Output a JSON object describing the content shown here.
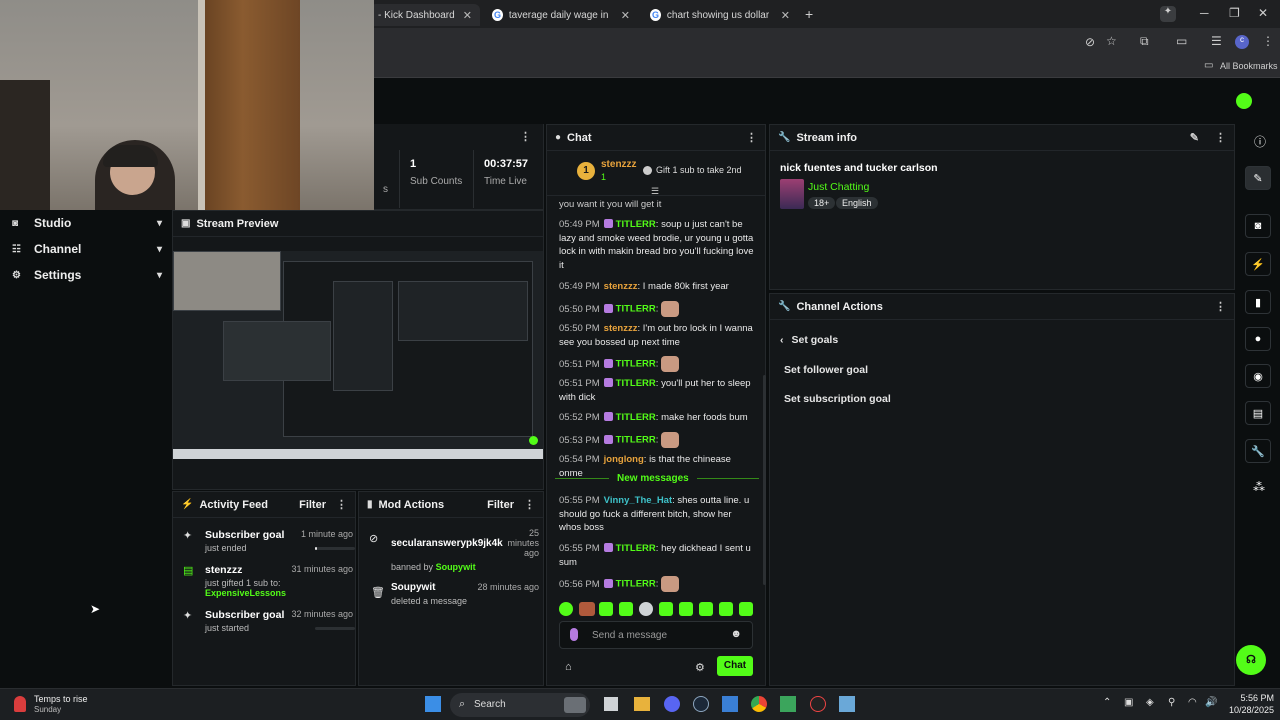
{
  "browser": {
    "tabs": [
      {
        "title": "- Kick Dashboard",
        "active": true
      },
      {
        "title": "taverage daily wage in africa - G",
        "active": false
      },
      {
        "title": "chart showing us dollar power",
        "active": false
      }
    ],
    "bookmarks_label": "All Bookmarks"
  },
  "sidebar": {
    "items": [
      {
        "label": "Studio"
      },
      {
        "label": "Channel"
      },
      {
        "label": "Settings"
      }
    ]
  },
  "stats": {
    "sub_count_value": "1",
    "sub_count_label": "Sub Counts",
    "time_live_value": "00:37:57",
    "time_live_label": "Time Live",
    "partial_label": "s"
  },
  "stream_preview": {
    "title": "Stream Preview"
  },
  "activity_feed": {
    "title": "Activity Feed",
    "filter_label": "Filter",
    "items": [
      {
        "title": "Subscriber goal",
        "sub": "just ended",
        "time": "1 minute ago",
        "progress": 0.05
      },
      {
        "title": "stenzzz",
        "sub": "just gifted 1 sub to:",
        "sub_highlight": "ExpensiveLessons",
        "time": "31 minutes ago"
      },
      {
        "title": "Subscriber goal",
        "sub": "just started",
        "time": "32 minutes ago",
        "progress": 0.0
      }
    ]
  },
  "mod_actions": {
    "title": "Mod Actions",
    "filter_label": "Filter",
    "items": [
      {
        "user": "secularanswerypk9jk4k",
        "action_prefix": "banned by",
        "actor": "Soupywit",
        "time": "25 minutes ago"
      },
      {
        "user": "Soupywit",
        "action": "deleted a message",
        "time": "28 minutes ago"
      }
    ]
  },
  "chat": {
    "title": "Chat",
    "pinned_user": "stenzzz",
    "pinned_rank": "1",
    "pinned_count": "1",
    "gift_text": "Gift 1 sub to take 2nd",
    "truncated_top": "you want it you will get it",
    "messages": [
      {
        "time": "05:49 PM",
        "user": "TITLERR",
        "color": "#53fc18",
        "badge": true,
        "text": "soup u just can't be lazy and smoke weed brodie, ur young u gotta lock in with makin bread bro you'll fucking love it"
      },
      {
        "time": "05:49 PM",
        "user": "stenzzz",
        "color": "#e8a33c",
        "badge": false,
        "text": "I made 80k first year"
      },
      {
        "time": "05:50 PM",
        "user": "TITLERR",
        "color": "#53fc18",
        "badge": true,
        "text": ""
      },
      {
        "time": "05:50 PM",
        "user": "stenzzz",
        "color": "#e8a33c",
        "badge": false,
        "text": "I'm out bro lock in I wanna see you bossed up next time"
      },
      {
        "time": "05:51 PM",
        "user": "TITLERR",
        "color": "#53fc18",
        "badge": true,
        "text": ""
      },
      {
        "time": "05:51 PM",
        "user": "TITLERR",
        "color": "#53fc18",
        "badge": true,
        "text": "you'll put her to sleep with dick"
      },
      {
        "time": "05:52 PM",
        "user": "TITLERR",
        "color": "#53fc18",
        "badge": true,
        "text": "make her foods bum"
      },
      {
        "time": "05:53 PM",
        "user": "TITLERR",
        "color": "#53fc18",
        "badge": true,
        "text": ""
      },
      {
        "time": "05:54 PM",
        "user": "jonglong",
        "color": "#e8a33c",
        "badge": false,
        "text": "is that the chinease onme"
      }
    ],
    "new_messages_label": "New messages",
    "new_messages": [
      {
        "time": "05:55 PM",
        "user": "Vinny_The_Hat",
        "color": "#3ec2c9",
        "badge": false,
        "text": "shes outta line. u should go fuck a different bitch, show her whos boss"
      },
      {
        "time": "05:55 PM",
        "user": "TITLERR",
        "color": "#53fc18",
        "badge": true,
        "text": "hey dickhead I sent u sum"
      },
      {
        "time": "05:56 PM",
        "user": "TITLERR",
        "color": "#53fc18",
        "badge": true,
        "text": ""
      }
    ],
    "input_placeholder": "Send a message",
    "send_label": "Chat"
  },
  "stream_info": {
    "title": "Stream info",
    "stream_title": "nick fuentes and tucker carlson",
    "category": "Just Chatting",
    "tags": [
      "18+",
      "English"
    ]
  },
  "channel_actions": {
    "title": "Channel Actions",
    "back_label": "Set goals",
    "options": [
      "Set follower goal",
      "Set subscription goal"
    ]
  },
  "taskbar": {
    "weather_title": "Temps to rise",
    "weather_sub": "Sunday",
    "search_label": "Search",
    "time": "5:56 PM",
    "date": "10/28/2025"
  },
  "colors": {
    "brand": "#53fc18",
    "panel": "#141719",
    "bg": "#0b0e0f"
  }
}
